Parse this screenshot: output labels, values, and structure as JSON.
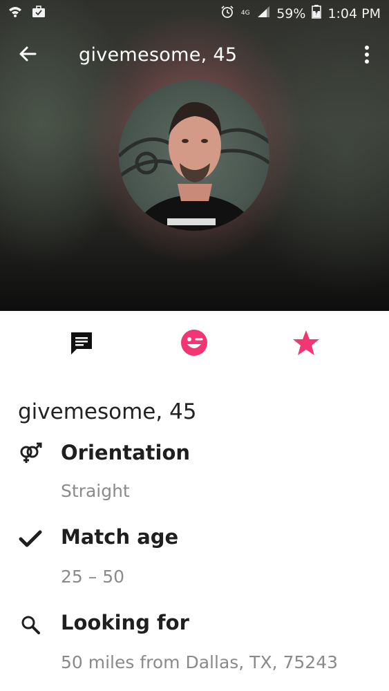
{
  "status_bar": {
    "battery": "59%",
    "time": "1:04 PM",
    "network": "4G",
    "icons": [
      "wifi-icon",
      "briefcase-icon",
      "alarm-icon",
      "signal-icon",
      "battery-icon"
    ]
  },
  "toolbar": {
    "title": "givemesome, 45",
    "icons": [
      "back-arrow-icon",
      "more-vert-icon"
    ]
  },
  "actions": {
    "items": [
      {
        "icon": "chat-icon",
        "color": "#111111"
      },
      {
        "icon": "wink-icon",
        "color": "#f23673"
      },
      {
        "icon": "star-icon",
        "color": "#f23673"
      }
    ]
  },
  "profile": {
    "name": "givemesome, 45",
    "rows": [
      {
        "icon": "gender-icon",
        "title": "Orientation",
        "value": "Straight"
      },
      {
        "icon": "check-icon",
        "title": "Match age",
        "value": "25 – 50"
      },
      {
        "icon": "search-icon",
        "title": "Looking for",
        "value": "50 miles from Dallas, TX, 75243"
      }
    ]
  },
  "colors": {
    "accent": "#f23673",
    "text_primary": "#1f1f1f",
    "text_secondary": "#8a8a8a"
  }
}
